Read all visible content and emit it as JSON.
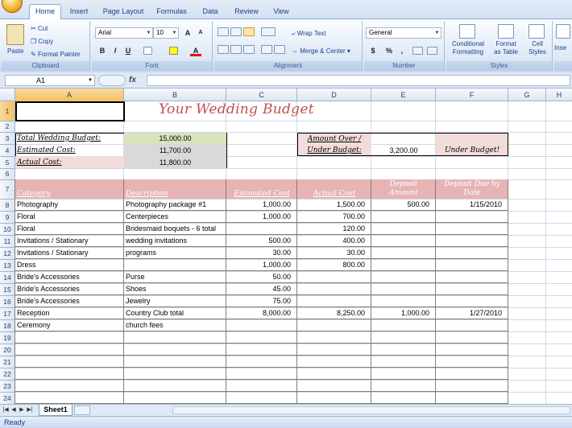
{
  "ribbon": {
    "tabs": [
      "Home",
      "Insert",
      "Page Layout",
      "Formulas",
      "Data",
      "Review",
      "View"
    ],
    "clipboard": {
      "paste": "Paste",
      "cut": "Cut",
      "copy": "Copy",
      "format_painter": "Format Painter",
      "label": "Clipboard"
    },
    "font": {
      "name": "Arial",
      "size": "10",
      "label": "Font",
      "bold": "B",
      "italic": "I",
      "underline": "U",
      "grow": "A",
      "shrink": "A",
      "font_color": "A"
    },
    "alignment": {
      "wrap": "Wrap Text",
      "merge": "Merge & Center",
      "label": "Alignment"
    },
    "number": {
      "format": "General",
      "currency": "$",
      "percent": "%",
      "comma": ",",
      "label": "Number"
    },
    "styles": {
      "conditional": "Conditional",
      "conditional2": "Formatting",
      "format_table": "Format",
      "format_table2": "as Table",
      "cell_styles": "Cell",
      "cell_styles2": "Styles",
      "label": "Styles"
    },
    "cells": {
      "insert": "Inse"
    }
  },
  "formula_bar": {
    "name_box": "A1",
    "fx": "fx",
    "value": ""
  },
  "columns": [
    "A",
    "B",
    "C",
    "D",
    "E",
    "F",
    "G",
    "H"
  ],
  "rows": [
    "1",
    "2",
    "3",
    "4",
    "5",
    "6",
    "7",
    "8",
    "9",
    "10",
    "11",
    "12",
    "13",
    "14",
    "15",
    "16",
    "17",
    "18",
    "19",
    "20",
    "21",
    "22",
    "23",
    "24",
    "25"
  ],
  "sheet": {
    "title": "Your Wedding Budget",
    "summary": {
      "total_label": "Total Wedding Budget:",
      "total_value": "15,000.00",
      "estimated_label": "Estimated Cost:",
      "estimated_value": "11,700.00",
      "actual_label": "Actual Cost:",
      "actual_value": "11,800.00",
      "over_label1": "Amount Over /",
      "over_label2": "Under Budget:",
      "over_value": "3,200.00",
      "under_text": "Under Budget!"
    },
    "headers": {
      "category": "Category",
      "description": "Description",
      "estimated": "Estimated Cost",
      "actual": "Actual Cost",
      "deposit1": "Deposit",
      "deposit2": "Amount",
      "due1": "Deposit Due by",
      "due2": "Date"
    },
    "items": [
      {
        "category": "Photography",
        "description": "Photography package #1",
        "estimated": "1,000.00",
        "actual": "1,500.00",
        "deposit": "500.00",
        "due": "1/15/2010"
      },
      {
        "category": "Floral",
        "description": "Centerpieces",
        "estimated": "1,000.00",
        "actual": "700.00",
        "deposit": "",
        "due": ""
      },
      {
        "category": "Floral",
        "description": "Bridesmaid boquets - 6 total",
        "estimated": "",
        "actual": "120.00",
        "deposit": "",
        "due": ""
      },
      {
        "category": "Invitations / Stationary",
        "description": "wedding invitations",
        "estimated": "500.00",
        "actual": "400.00",
        "deposit": "",
        "due": ""
      },
      {
        "category": "Invitations / Stationary",
        "description": "programs",
        "estimated": "30.00",
        "actual": "30.00",
        "deposit": "",
        "due": ""
      },
      {
        "category": "Dress",
        "description": "",
        "estimated": "1,000.00",
        "actual": "800.00",
        "deposit": "",
        "due": ""
      },
      {
        "category": "Bride's Accessories",
        "description": "Purse",
        "estimated": "50.00",
        "actual": "",
        "deposit": "",
        "due": ""
      },
      {
        "category": "Bride's Accessories",
        "description": "Shoes",
        "estimated": "45.00",
        "actual": "",
        "deposit": "",
        "due": ""
      },
      {
        "category": "Bride's Accessories",
        "description": "Jewelry",
        "estimated": "75.00",
        "actual": "",
        "deposit": "",
        "due": ""
      },
      {
        "category": "Reception",
        "description": "Country Club total",
        "estimated": "8,000.00",
        "actual": "8,250.00",
        "deposit": "1,000.00",
        "due": "1/27/2010"
      },
      {
        "category": "Ceremony",
        "description": "church fees",
        "estimated": "",
        "actual": "",
        "deposit": "",
        "due": ""
      }
    ]
  },
  "sheet_tabs": {
    "active": "Sheet1"
  },
  "status": {
    "text": "Ready"
  },
  "colors": {
    "accent": "#c0504d",
    "header_fill": "#e6b4b4",
    "total_fill": "#d8e4bc",
    "gray_fill": "#d9d9d9"
  }
}
